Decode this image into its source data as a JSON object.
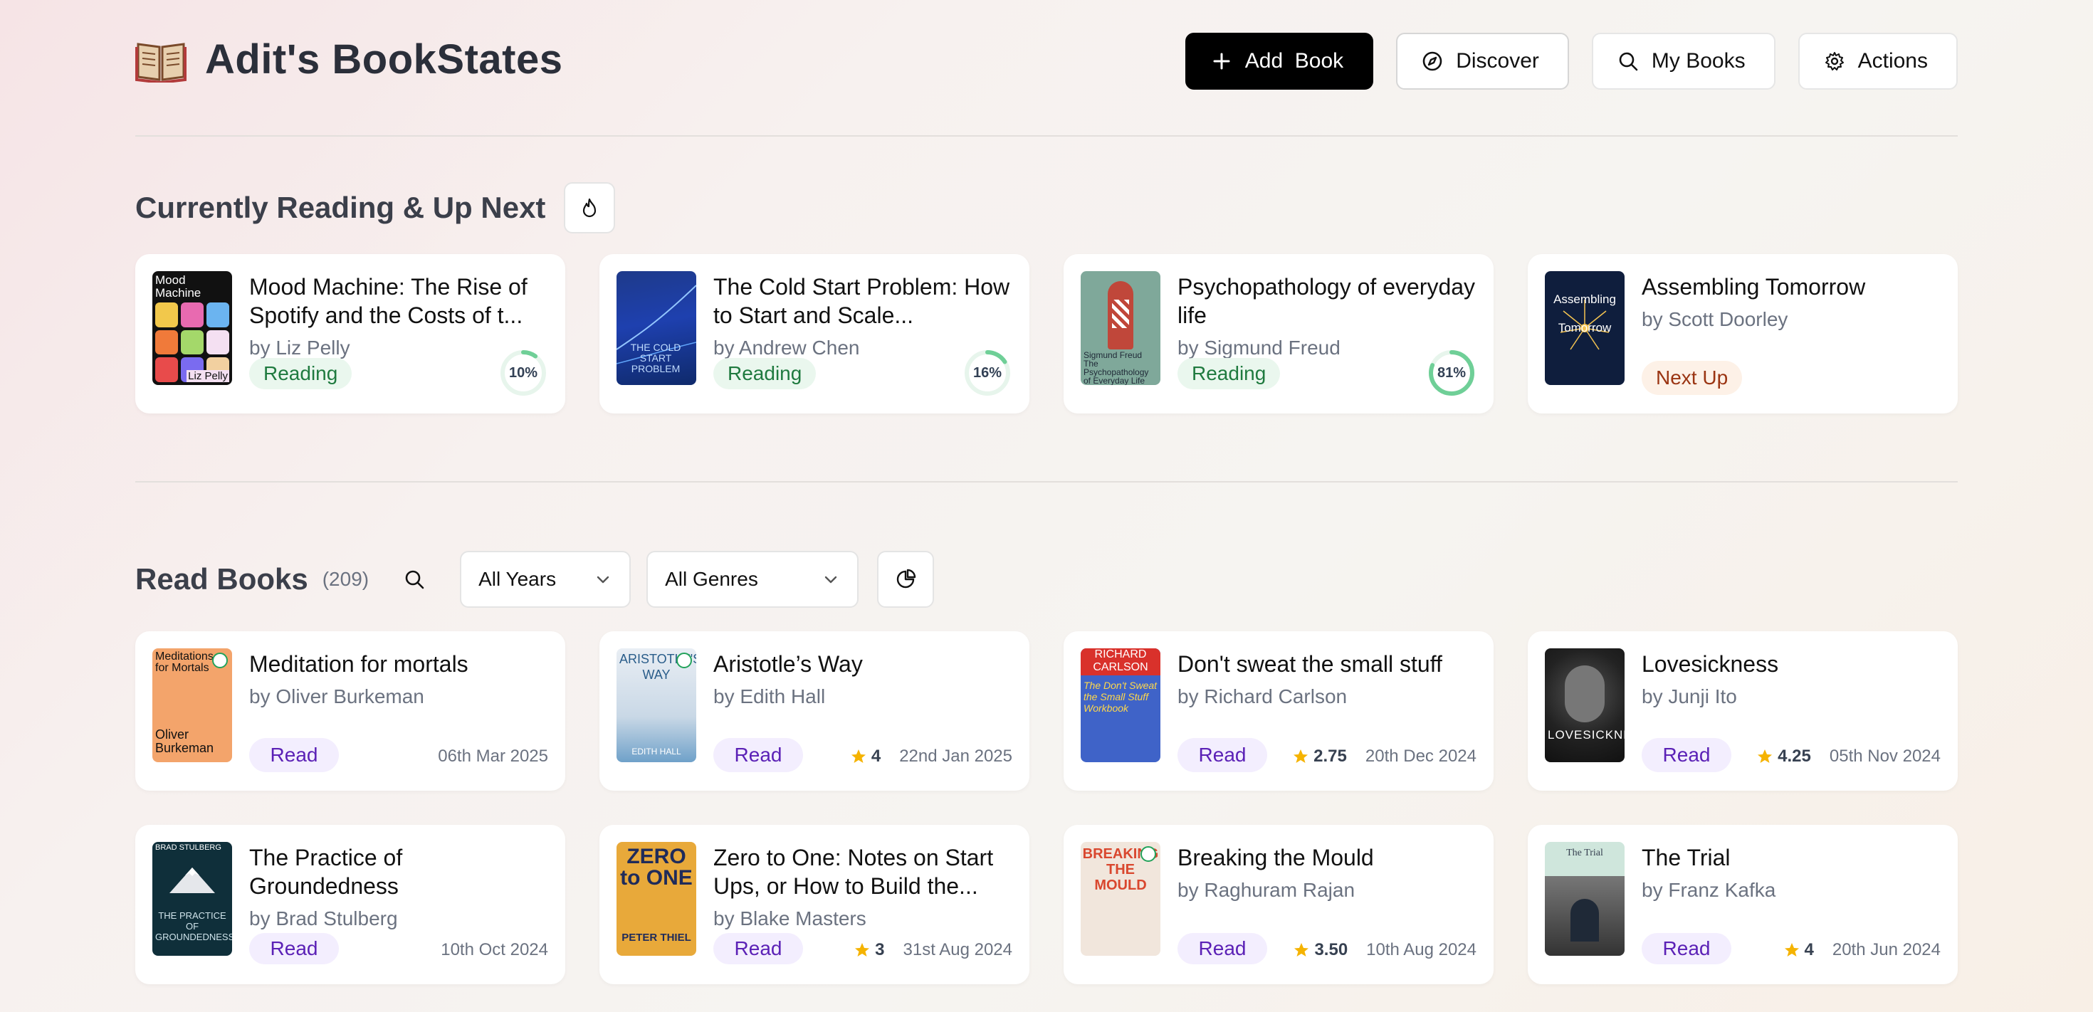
{
  "header": {
    "title": "Adit's BookStates",
    "logo_icon": "open-book-icon",
    "nav": [
      {
        "label": "Add  Book",
        "icon": "plus-icon"
      },
      {
        "label": "Discover",
        "icon": "compass-icon"
      },
      {
        "label": "My Books",
        "icon": "search-icon"
      },
      {
        "label": "Actions",
        "icon": "gear-icon"
      }
    ]
  },
  "current": {
    "title": "Currently Reading & Up Next",
    "icon": "flame-icon",
    "books": [
      {
        "title": "Mood Machine: The Rise of Spotify and the Costs of t...",
        "author": "by Liz Pelly",
        "status": "Reading",
        "progress": 10,
        "progress_label": "10%",
        "cover_text": "Mood Machine",
        "cover_author": "Liz Pelly"
      },
      {
        "title": "The Cold Start Problem: How to Start and Scale...",
        "author": "by Andrew Chen",
        "status": "Reading",
        "progress": 16,
        "progress_label": "16%",
        "cover_text": "THE COLD START PROBLEM"
      },
      {
        "title": "Psychopathology of everyday life",
        "author": "by Sigmund Freud",
        "status": "Reading",
        "progress": 81,
        "progress_label": "81%",
        "cover_text": "Sigmund Freud The Psychopathology of Everyday Life"
      },
      {
        "title": "Assembling Tomorrow",
        "author": "by Scott Doorley",
        "status": "Next Up",
        "cover_text": "Assembling Tomorrow"
      }
    ]
  },
  "read": {
    "title": "Read Books",
    "count": "(209)",
    "filters": {
      "years": "All Years",
      "genres": "All Genres"
    },
    "books": [
      {
        "title": "Meditation for mortals",
        "author": "by Oliver Burkeman",
        "status": "Read",
        "rating": "",
        "date": "06th Mar 2025",
        "cover_text": "Meditations for Mortals",
        "cover_author": "Oliver Burkeman"
      },
      {
        "title": "Aristotle’s Way",
        "author": "by Edith Hall",
        "status": "Read",
        "rating": "4",
        "date": "22nd Jan 2025",
        "cover_text": "ARISTOTLE'S WAY",
        "cover_author": "EDITH HALL"
      },
      {
        "title": "Don't sweat the small stuff",
        "author": "by Richard Carlson",
        "status": "Read",
        "rating": "2.75",
        "date": "20th Dec 2024",
        "cover_text": "RICHARD CARLSON",
        "cover_author": "The Don't Sweat the Small Stuff Workbook"
      },
      {
        "title": "Lovesickness",
        "author": "by Junji Ito",
        "status": "Read",
        "rating": "4.25",
        "date": "05th Nov 2024",
        "cover_text": "LOVESICKNESS"
      },
      {
        "title": "The Practice of Groundedness",
        "author": "by Brad Stulberg",
        "status": "Read",
        "rating": "",
        "date": "10th Oct 2024",
        "cover_text": "THE PRACTICE OF GROUNDEDNESS",
        "cover_author": "BRAD STULBERG"
      },
      {
        "title": "Zero to One: Notes on Start Ups, or How to Build the...",
        "author": "by Blake Masters",
        "status": "Read",
        "rating": "3",
        "date": "31st Aug 2024",
        "cover_text": "ZERO to ONE",
        "cover_author": "PETER THIEL"
      },
      {
        "title": "Breaking the Mould",
        "author": "by Raghuram Rajan",
        "status": "Read",
        "rating": "3.50",
        "date": "10th Aug 2024",
        "cover_text": "BREAKING THE MOULD"
      },
      {
        "title": "The Trial",
        "author": "by Franz Kafka",
        "status": "Read",
        "rating": "4",
        "date": "20th Jun 2024",
        "cover_text": "The Trial"
      }
    ]
  },
  "colors": {
    "reading_bg": "#eaf7ee",
    "reading_text": "#1f7a3f",
    "read_bg": "#f3eefe",
    "read_text": "#5b21b6",
    "next_bg": "#fdf1e7",
    "next_text": "#9a3412",
    "progress": "#6fcf97",
    "star": "#f5b301"
  }
}
